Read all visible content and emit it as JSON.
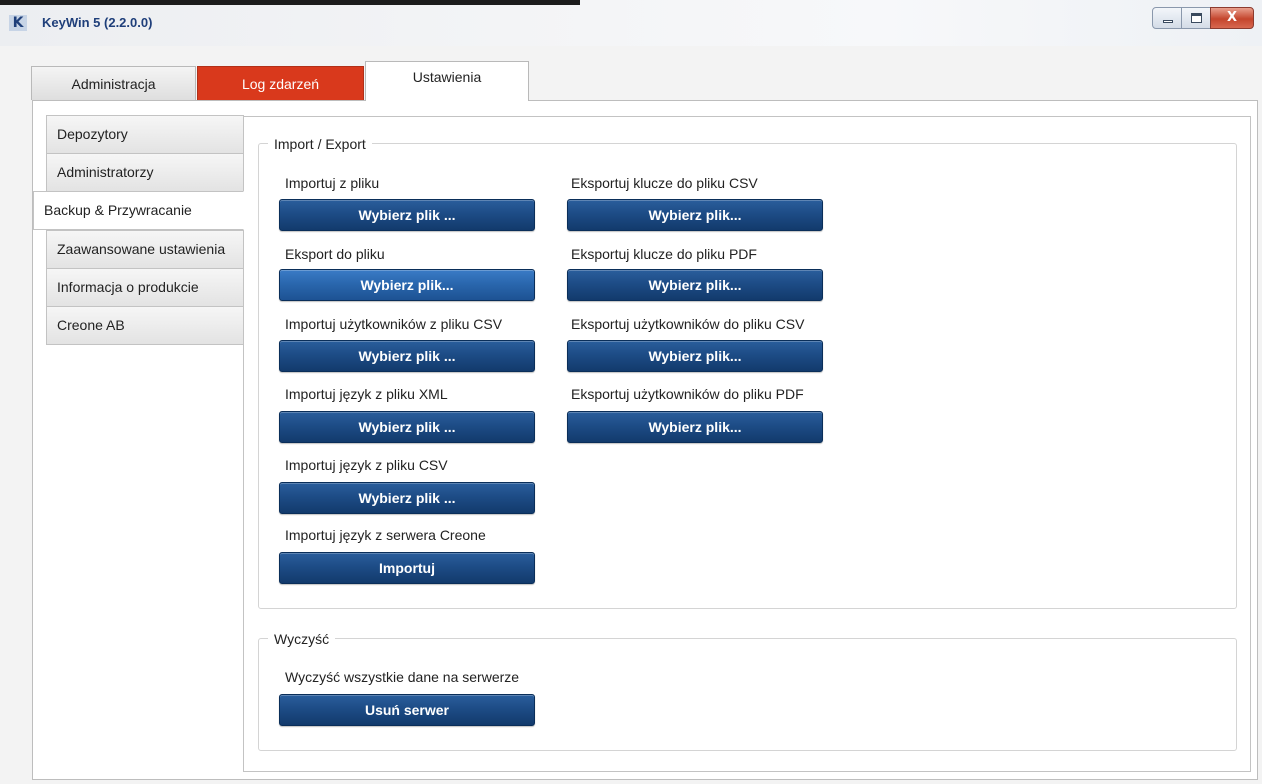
{
  "window": {
    "title": "KeyWin 5 (2.2.0.0)",
    "logo_letter": "K",
    "close_glyph": "X"
  },
  "tabs": [
    {
      "label": "Administracja",
      "state": "normal"
    },
    {
      "label": "Log zdarzeń",
      "state": "highlighted",
      "color": "#d9391c"
    },
    {
      "label": "Ustawienia",
      "state": "active"
    }
  ],
  "sidebar": {
    "items": [
      {
        "label": "Depozytory"
      },
      {
        "label": "Administratorzy"
      },
      {
        "label": "Backup & Przywracanie",
        "active": true
      },
      {
        "label": "Zaawansowane ustawienia"
      },
      {
        "label": "Informacja o produkcie"
      },
      {
        "label": "Creone AB"
      }
    ]
  },
  "import_export": {
    "legend": "Import / Export",
    "left": [
      {
        "label": "Importuj z pliku",
        "button": "Wybierz plik ..."
      },
      {
        "label": "Eksport do pliku",
        "button": "Wybierz plik..."
      },
      {
        "label": "Importuj użytkowników z pliku CSV",
        "button": "Wybierz plik ..."
      },
      {
        "label": "Importuj język z pliku XML",
        "button": "Wybierz plik ..."
      },
      {
        "label": "Importuj język z pliku CSV",
        "button": "Wybierz plik ..."
      },
      {
        "label": "Importuj język z serwera Creone",
        "button": "Importuj"
      }
    ],
    "right": [
      {
        "label": "Eksportuj klucze do pliku CSV",
        "button": "Wybierz plik..."
      },
      {
        "label": "Eksportuj klucze do pliku PDF",
        "button": "Wybierz plik..."
      },
      {
        "label": "Eksportuj użytkowników do pliku CSV",
        "button": "Wybierz plik..."
      },
      {
        "label": "Eksportuj użytkowników do pliku PDF",
        "button": "Wybierz plik..."
      }
    ]
  },
  "clear": {
    "legend": "Wyczyść",
    "label": "Wyczyść wszystkie dane na serwerze",
    "button": "Usuń serwer"
  },
  "colors": {
    "accent_button": "#1d4c86",
    "log_tab": "#d9391c",
    "title_text": "#1f3f7a"
  }
}
